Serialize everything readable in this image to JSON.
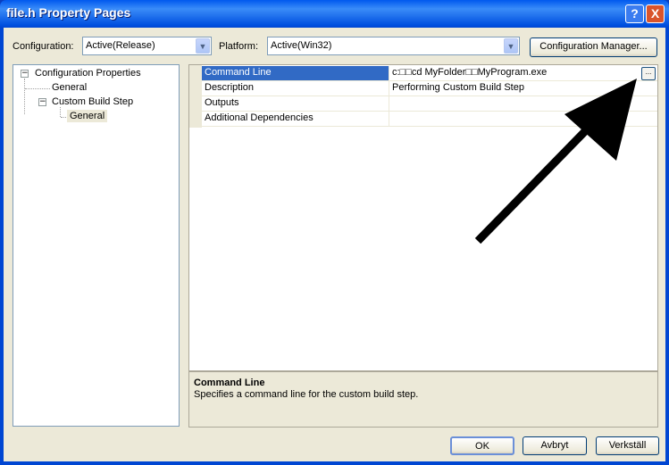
{
  "window": {
    "title": "file.h Property Pages",
    "help_label": "?",
    "close_label": "X"
  },
  "toolbar": {
    "configuration_label": "Configuration:",
    "configuration_value": "Active(Release)",
    "platform_label": "Platform:",
    "platform_value": "Active(Win32)",
    "config_manager_label": "Configuration Manager..."
  },
  "tree": {
    "items": [
      {
        "label": "Configuration Properties",
        "expander": "−"
      },
      {
        "label": "General"
      },
      {
        "label": "Custom Build Step",
        "expander": "−"
      },
      {
        "label": "General",
        "selected": true
      }
    ]
  },
  "grid": {
    "rows": [
      {
        "name": "Command Line",
        "value": "c:□□cd MyFolder□□MyProgram.exe",
        "selected": true
      },
      {
        "name": "Description",
        "value": "Performing Custom Build Step"
      },
      {
        "name": "Outputs",
        "value": ""
      },
      {
        "name": "Additional Dependencies",
        "value": ""
      }
    ],
    "ellipsis_label": "..."
  },
  "description": {
    "title": "Command Line",
    "text": "Specifies a command line for the custom build step."
  },
  "buttons": {
    "ok": "OK",
    "cancel": "Avbryt",
    "apply": "Verkställ"
  },
  "annotation": {
    "arrow_color": "#000000",
    "icon": "arrow-pointing-to-ellipsis-button"
  }
}
